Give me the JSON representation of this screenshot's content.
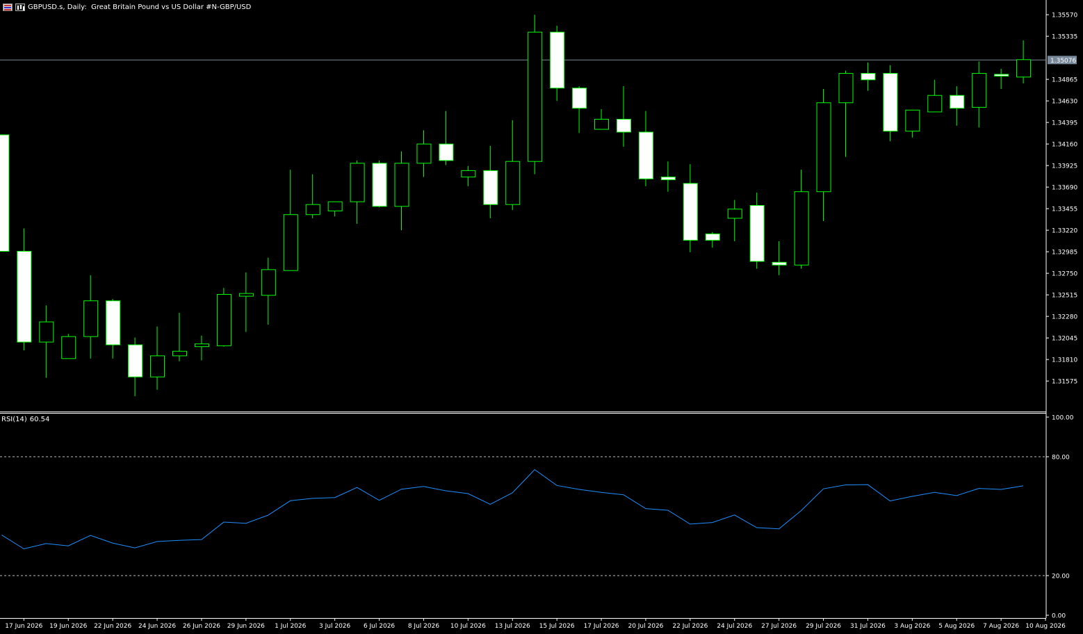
{
  "header": {
    "symbol": "GBPUSD.s",
    "timeframe": "Daily:",
    "description": "Great Britain Pound vs US Dollar #N-GBP/USD",
    "flag_icon": "flag-icon",
    "chart_icon": "bar-chart-icon"
  },
  "colors": {
    "background": "#000000",
    "bull_border": "#00FF00",
    "bull_fill": "#000000",
    "bear_fill": "#FFFFFF",
    "wick": "#00FF00",
    "axis_text": "#FFFFFF",
    "current_price_line": "#778899",
    "rsi_line": "#1E90FF",
    "level_line": "#C0C0C0"
  },
  "rsi": {
    "label": "RSI(14)",
    "value": "60.54"
  },
  "chart_data": [
    {
      "type": "candlestick",
      "price_axis_ticks": [
        "1.35570",
        "1.35335",
        "1.34865",
        "1.34630",
        "1.34395",
        "1.34160",
        "1.33925",
        "1.33690",
        "1.33455",
        "1.33220",
        "1.32985",
        "1.32750",
        "1.32515",
        "1.32280",
        "1.32045",
        "1.31810",
        "1.31575"
      ],
      "ylim": [
        1.3125,
        1.357
      ],
      "current_price": 1.35076,
      "current_price_label": "1.35076",
      "date_labels": [
        "17 Jun 2026",
        "19 Jun 2026",
        "22 Jun 2026",
        "24 Jun 2026",
        "26 Jun 2026",
        "29 Jun 2026",
        "1 Jul 2026",
        "3 Jul 2026",
        "6 Jul 2026",
        "8 Jul 2026",
        "10 Jul 2026",
        "13 Jul 2026",
        "15 Jul 2026",
        "17 Jul 2026",
        "20 Jul 2026",
        "22 Jul 2026",
        "24 Jul 2026",
        "27 Jul 2026",
        "29 Jul 2026",
        "31 Jul 2026",
        "3 Aug 2026",
        "5 Aug 2026",
        "7 Aug 2026",
        "10 Aug 2026"
      ],
      "ohlc": [
        {
          "o": 1.3426,
          "h": 1.3426,
          "l": 1.3299,
          "c": 1.3299
        },
        {
          "o": 1.3299,
          "h": 1.3324,
          "l": 1.3191,
          "c": 1.32
        },
        {
          "o": 1.32,
          "h": 1.324,
          "l": 1.3161,
          "c": 1.3222
        },
        {
          "o": 1.3182,
          "h": 1.3209,
          "l": 1.3182,
          "c": 1.3206
        },
        {
          "o": 1.3206,
          "h": 1.3273,
          "l": 1.3182,
          "c": 1.3245
        },
        {
          "o": 1.3245,
          "h": 1.3247,
          "l": 1.3182,
          "c": 1.3197
        },
        {
          "o": 1.3197,
          "h": 1.3205,
          "l": 1.3141,
          "c": 1.3162
        },
        {
          "o": 1.3162,
          "h": 1.3217,
          "l": 1.3148,
          "c": 1.3185
        },
        {
          "o": 1.3185,
          "h": 1.3232,
          "l": 1.3179,
          "c": 1.319
        },
        {
          "o": 1.3195,
          "h": 1.3207,
          "l": 1.318,
          "c": 1.3198
        },
        {
          "o": 1.3196,
          "h": 1.3259,
          "l": 1.3195,
          "c": 1.3252
        },
        {
          "o": 1.325,
          "h": 1.3276,
          "l": 1.3211,
          "c": 1.3253
        },
        {
          "o": 1.3251,
          "h": 1.3292,
          "l": 1.3219,
          "c": 1.3279
        },
        {
          "o": 1.3278,
          "h": 1.3388,
          "l": 1.3278,
          "c": 1.3339
        },
        {
          "o": 1.3339,
          "h": 1.3383,
          "l": 1.3335,
          "c": 1.335
        },
        {
          "o": 1.3343,
          "h": 1.3353,
          "l": 1.3337,
          "c": 1.3353
        },
        {
          "o": 1.3353,
          "h": 1.3398,
          "l": 1.3329,
          "c": 1.3395
        },
        {
          "o": 1.3395,
          "h": 1.3398,
          "l": 1.3347,
          "c": 1.3348
        },
        {
          "o": 1.3348,
          "h": 1.3408,
          "l": 1.3322,
          "c": 1.3395
        },
        {
          "o": 1.3395,
          "h": 1.3431,
          "l": 1.338,
          "c": 1.3416
        },
        {
          "o": 1.3416,
          "h": 1.3452,
          "l": 1.3393,
          "c": 1.3398
        },
        {
          "o": 1.338,
          "h": 1.3392,
          "l": 1.337,
          "c": 1.3387
        },
        {
          "o": 1.3387,
          "h": 1.3414,
          "l": 1.3335,
          "c": 1.335
        },
        {
          "o": 1.335,
          "h": 1.3442,
          "l": 1.3344,
          "c": 1.3397
        },
        {
          "o": 1.3397,
          "h": 1.3557,
          "l": 1.3383,
          "c": 1.3538
        },
        {
          "o": 1.3538,
          "h": 1.3545,
          "l": 1.3463,
          "c": 1.3477
        },
        {
          "o": 1.3477,
          "h": 1.3479,
          "l": 1.3428,
          "c": 1.3455
        },
        {
          "o": 1.3432,
          "h": 1.3454,
          "l": 1.3432,
          "c": 1.3443
        },
        {
          "o": 1.3443,
          "h": 1.3479,
          "l": 1.3413,
          "c": 1.3429
        },
        {
          "o": 1.3429,
          "h": 1.3452,
          "l": 1.337,
          "c": 1.3378
        },
        {
          "o": 1.338,
          "h": 1.3397,
          "l": 1.3364,
          "c": 1.3377
        },
        {
          "o": 1.3373,
          "h": 1.3394,
          "l": 1.3298,
          "c": 1.3311
        },
        {
          "o": 1.3318,
          "h": 1.332,
          "l": 1.3303,
          "c": 1.3311
        },
        {
          "o": 1.3335,
          "h": 1.3355,
          "l": 1.331,
          "c": 1.3345
        },
        {
          "o": 1.3349,
          "h": 1.3363,
          "l": 1.328,
          "c": 1.3288
        },
        {
          "o": 1.3287,
          "h": 1.331,
          "l": 1.3273,
          "c": 1.3284
        },
        {
          "o": 1.3284,
          "h": 1.3388,
          "l": 1.328,
          "c": 1.3364
        },
        {
          "o": 1.3364,
          "h": 1.3476,
          "l": 1.3332,
          "c": 1.3461
        },
        {
          "o": 1.3461,
          "h": 1.3496,
          "l": 1.3402,
          "c": 1.3493
        },
        {
          "o": 1.3493,
          "h": 1.3505,
          "l": 1.3474,
          "c": 1.3486
        },
        {
          "o": 1.3493,
          "h": 1.3502,
          "l": 1.3419,
          "c": 1.343
        },
        {
          "o": 1.343,
          "h": 1.3444,
          "l": 1.3423,
          "c": 1.3453
        },
        {
          "o": 1.3451,
          "h": 1.3486,
          "l": 1.3451,
          "c": 1.3469
        },
        {
          "o": 1.3469,
          "h": 1.3479,
          "l": 1.3436,
          "c": 1.3455
        },
        {
          "o": 1.3456,
          "h": 1.3506,
          "l": 1.3434,
          "c": 1.3493
        },
        {
          "o": 1.3492,
          "h": 1.3498,
          "l": 1.3476,
          "c": 1.349
        },
        {
          "o": 1.3489,
          "h": 1.3529,
          "l": 1.3482,
          "c": 1.3508
        }
      ]
    },
    {
      "type": "line",
      "title": "RSI(14) 60.54",
      "ylim": [
        0,
        100
      ],
      "y_ticks": [
        "100.00",
        "80.00",
        "20.00",
        "0.00"
      ],
      "levels": [
        80,
        20
      ],
      "values": [
        40.5,
        33.5,
        36.2,
        35.0,
        40.3,
        36.4,
        34.0,
        37.2,
        37.8,
        38.2,
        47.0,
        46.4,
        50.5,
        57.8,
        59.0,
        59.4,
        64.5,
        58.0,
        63.6,
        65.0,
        62.8,
        61.4,
        56.0,
        61.8,
        73.5,
        65.5,
        63.5,
        62.0,
        60.8,
        53.8,
        53.0,
        46.0,
        46.8,
        50.6,
        44.2,
        43.6,
        52.8,
        63.8,
        65.8,
        65.9,
        57.7,
        60.0,
        62.0,
        60.4,
        64.0,
        63.5,
        65.3
      ]
    }
  ]
}
